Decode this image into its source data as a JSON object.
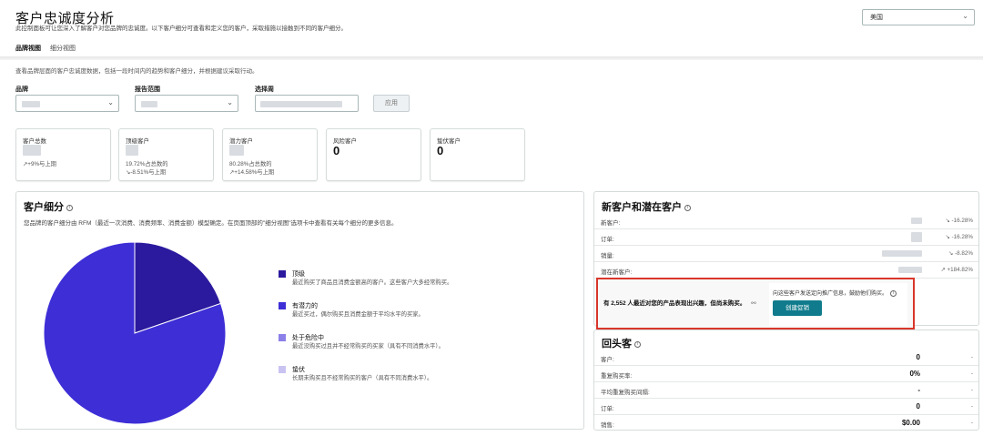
{
  "header": {
    "title": "客户忠诚度分析",
    "subtitle": "此控制面板可让您深入了解客户对您品牌的忠诚度。以下客户细分可查看和定义您的客户，采取措施以接触到不同的客户细分。",
    "country": "美国"
  },
  "tabs": [
    "品牌视图",
    "细分视图"
  ],
  "description": "查看品牌层面的客户忠诚度数据，包括一段时间内的趋势和客户细分，并根据建议采取行动。",
  "filters": {
    "brand_label": "品牌",
    "range_label": "报告范围",
    "week_label": "选择周",
    "apply": "应用"
  },
  "kpis": [
    {
      "label": "客户总数",
      "value": "",
      "line1": "↗+9%与上期",
      "line2": ""
    },
    {
      "label": "顶级客户",
      "value": "",
      "line1": "19.72%占总数的",
      "line2": "↘-8.51%与上期"
    },
    {
      "label": "潜力客户",
      "value": "",
      "line1": "80.28%占总数的",
      "line2": "↗+14.58%与上期"
    },
    {
      "label": "风险客户",
      "value": "0",
      "line1": "",
      "line2": ""
    },
    {
      "label": "蛰伏客户",
      "value": "0",
      "line1": "",
      "line2": ""
    }
  ],
  "segments": {
    "title": "客户细分",
    "description": "您品牌的客户细分由 RFM（最近一次消费、消费频率、消费金额）模型确定。在页面顶部的\"细分视图\"选项卡中查看有关每个细分的更多信息。",
    "legend": [
      {
        "name": "顶级",
        "desc": "最近购买了商品且消费金额高的客户。这些客户大多经常购买。",
        "color": "#2b1a9e"
      },
      {
        "name": "有潜力的",
        "desc": "最近买过，偶尔购买且消费金额于平均水平的买家。",
        "color": "#3d2ed6"
      },
      {
        "name": "处于危险中",
        "desc": "最近没购买过且并不经常购买的买家（具有不同消费水平）。",
        "color": "#8b7fe8"
      },
      {
        "name": "蛰伏",
        "desc": "长期未购买且不经常购买的客户（具有不同消费水平）。",
        "color": "#c9c3f2"
      }
    ],
    "chart_data": {
      "type": "pie",
      "categories": [
        "顶级",
        "有潜力的",
        "处于危险中",
        "蛰伏"
      ],
      "values": [
        19.72,
        80.28,
        0,
        0
      ]
    }
  },
  "new_customers": {
    "title": "新客户和潜在客户",
    "rows": [
      {
        "label": "新客户:",
        "change": "↘ -16.28%"
      },
      {
        "label": "订单:",
        "change": "↘ -16.28%"
      },
      {
        "label": "销量:",
        "change": "↘ -8.82%"
      },
      {
        "label": "潜在新客户:",
        "change": "↗ +184.82%"
      }
    ],
    "callout": {
      "text": "有 2,552 人最近对您的产品表现出兴趣，但尚未购买。",
      "note": "向这些客户发送定向推广信息，鼓励他们购买。",
      "button": "创建促销"
    }
  },
  "repeat": {
    "title": "回头客",
    "rows": [
      {
        "label": "客户:",
        "value": "0",
        "change": "-"
      },
      {
        "label": "重复购买率:",
        "value": "0%",
        "change": "-"
      },
      {
        "label": "平均重复购买间隔:",
        "value": "-",
        "change": "-"
      },
      {
        "label": "订单:",
        "value": "0",
        "change": "-"
      },
      {
        "label": "销售:",
        "value": "$0.00",
        "change": "-"
      }
    ]
  }
}
